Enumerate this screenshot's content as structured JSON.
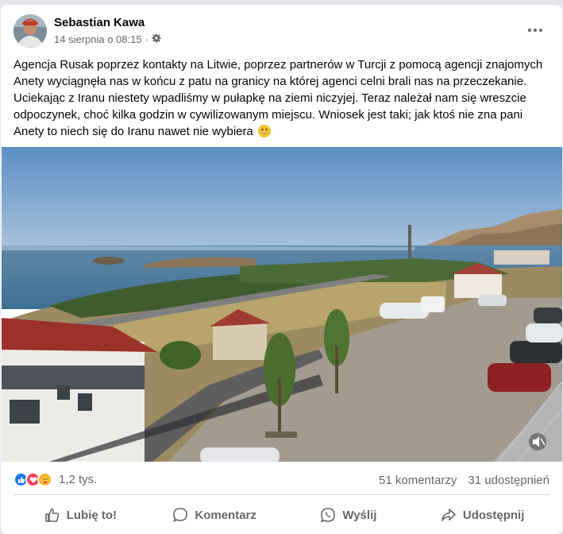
{
  "post": {
    "author": "Sebastian Kawa",
    "timestamp": "14 sierpnia o 08:15",
    "separator": "·",
    "audience_icon": "gear-icon",
    "text": "Agencja Rusak poprzez kontakty na Litwie,  poprzez partnerów w Turcji z pomocą agencji znajomych Anety wyciągnęła nas w końcu z patu na granicy na której agenci celni brali nas na przeczekanie. Uciekając z Iranu niestety wpadliśmy w pułapkę na ziemi niczyjej. Teraz należał nam się wreszcie odpoczynek, choć kilka godzin w cywilizowanym miejscu. Wniosek jest taki; jak ktoś nie zna pani Anety to niech się do Iranu nawet nie wybiera",
    "text_emoji": "grinning-face-emoji"
  },
  "stats": {
    "reaction_icons": [
      "like-icon",
      "love-icon",
      "care-icon"
    ],
    "reaction_count": "1,2 tys.",
    "comments": "51 komentarzy",
    "shares": "31 udostępnień"
  },
  "actions": {
    "like": "Lubię to!",
    "comment": "Komentarz",
    "send": "Wyślij",
    "share": "Udostępnij"
  },
  "colors": {
    "like_blue": "#1877f2",
    "love_red": "#f33e58",
    "care_yellow": "#f7b125",
    "secondary_text": "#65676b"
  }
}
